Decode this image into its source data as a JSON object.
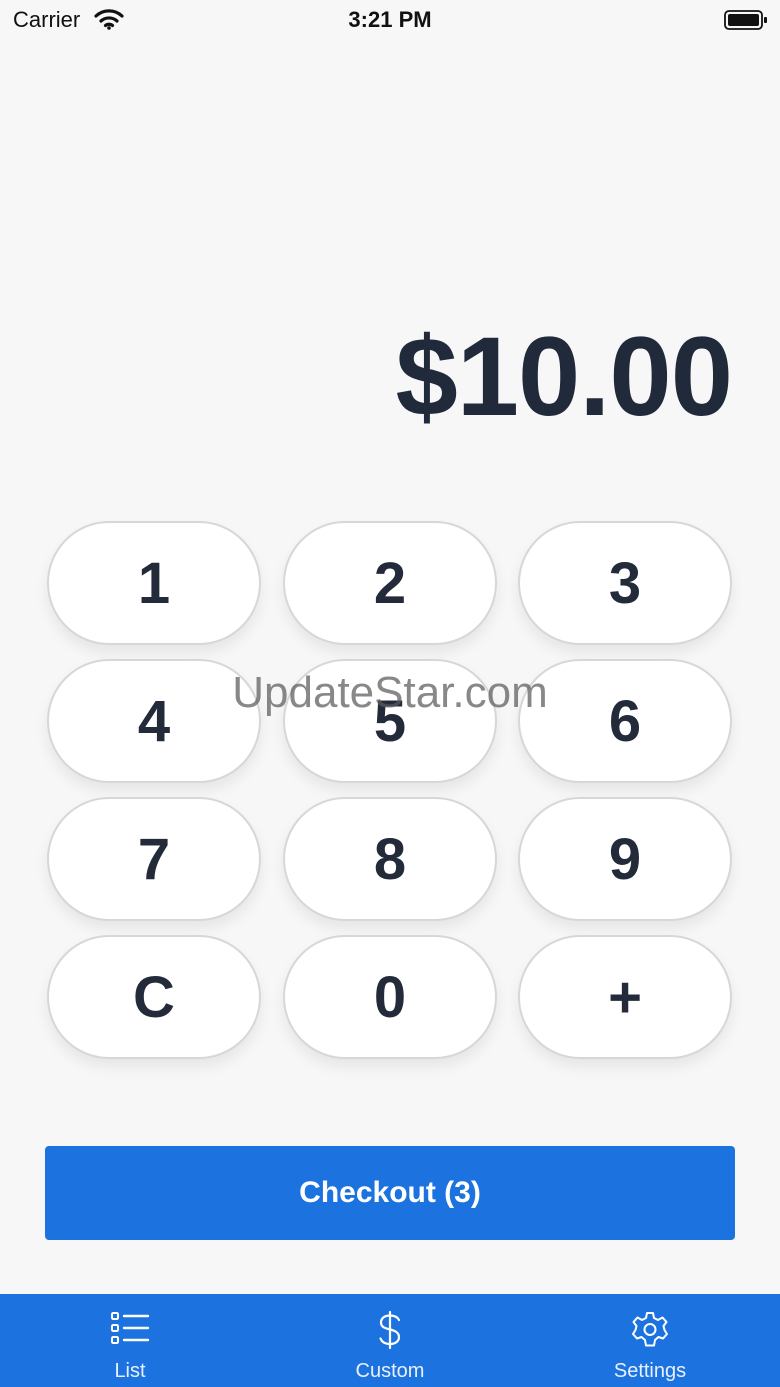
{
  "status_bar": {
    "carrier": "Carrier",
    "time": "3:21 PM",
    "wifi_icon": "wifi-icon",
    "battery_icon": "battery-icon"
  },
  "display": {
    "amount": "$10.00"
  },
  "keypad": {
    "keys": [
      "1",
      "2",
      "3",
      "4",
      "5",
      "6",
      "7",
      "8",
      "9",
      "C",
      "0",
      "+"
    ]
  },
  "watermark": "UpdateStar.com",
  "checkout": {
    "label": "Checkout (3)"
  },
  "tab_bar": {
    "tabs": [
      {
        "label": "List",
        "icon": "list-icon"
      },
      {
        "label": "Custom",
        "icon": "dollar-icon"
      },
      {
        "label": "Settings",
        "icon": "gear-icon"
      }
    ]
  },
  "colors": {
    "accent": "#1c73e0",
    "background": "#f7f7f8",
    "key_text": "#232b3b"
  }
}
